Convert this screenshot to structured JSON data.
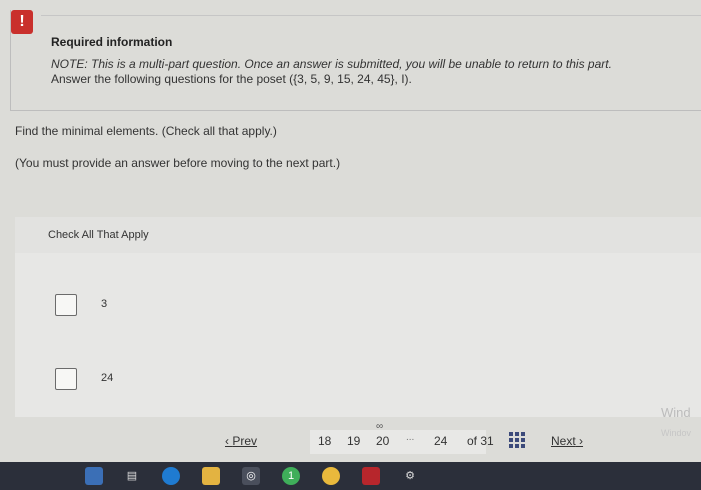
{
  "alert": {
    "icon_text": "!",
    "title": "Required information"
  },
  "note": "NOTE: This is a multi-part question. Once an answer is submitted, you will be unable to return to this part.",
  "intro": "Answer the following questions for the poset ({3, 5, 9, 15, 24, 45}, I).",
  "question": "Find the minimal elements. (Check all that apply.)",
  "warning": "(You must provide an answer before moving to the next part.)",
  "answer": {
    "header": "Check All That Apply",
    "options": [
      {
        "label": "3",
        "checked": false
      },
      {
        "label": "24",
        "checked": false
      }
    ]
  },
  "watermark": {
    "line1": "Wind",
    "line2": "Windov"
  },
  "pager": {
    "prev_label": "Prev",
    "pages": [
      "18",
      "19",
      "20",
      "24"
    ],
    "dots": "...",
    "of_label": "of",
    "total": "31",
    "next_label": "Next"
  },
  "taskbar": {
    "icons": [
      "file-explorer-icon",
      "task-view-icon",
      "edge-icon",
      "folder-icon",
      "camera-icon",
      "whatsapp-icon",
      "chrome-icon",
      "acrobat-icon",
      "settings-icon"
    ],
    "whatsapp_badge": "1"
  }
}
